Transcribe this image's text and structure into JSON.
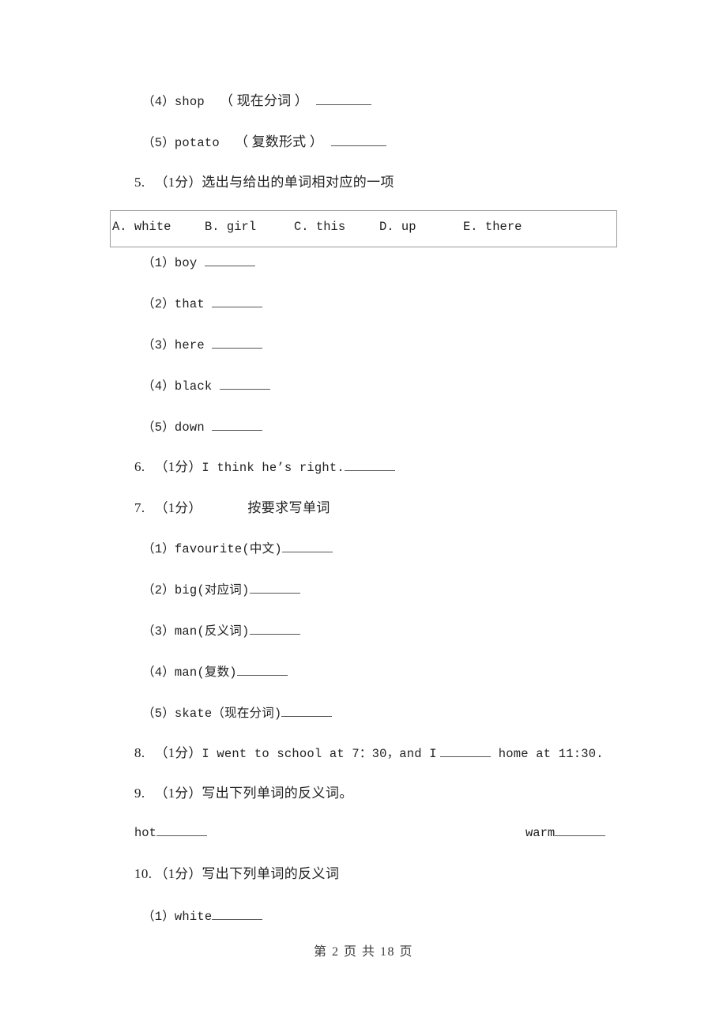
{
  "document": {
    "type": "exam-worksheet",
    "language": "zh-CN",
    "background_color": "#ffffff",
    "text_color": "#222222"
  },
  "carryover_items": [
    {
      "marker": "（4）",
      "word": "shop",
      "hint": "（ 现在分词 ）",
      "blank": "________"
    },
    {
      "marker": "（5）",
      "word": "potato",
      "hint": "（ 复数形式 ）",
      "blank": "________"
    }
  ],
  "questions": [
    {
      "number": "5.",
      "score": "（1分）",
      "prompt": "选出与给出的单词相对应的一项",
      "choices": [
        {
          "letter": "A.",
          "text": "white"
        },
        {
          "letter": "B.",
          "text": "girl"
        },
        {
          "letter": "C.",
          "text": "this"
        },
        {
          "letter": "D.",
          "text": "up"
        },
        {
          "letter": "E.",
          "text": "there"
        }
      ],
      "sub_items": [
        {
          "marker": "（1）",
          "word": "boy",
          "blank": "________"
        },
        {
          "marker": "（2）",
          "word": "that",
          "blank": "________"
        },
        {
          "marker": "（3）",
          "word": "here",
          "blank": "________"
        },
        {
          "marker": "（4）",
          "word": "black",
          "blank": "________"
        },
        {
          "marker": "（5）",
          "word": "down",
          "blank": "________"
        }
      ]
    },
    {
      "number": "6.",
      "score": "（1分）",
      "prompt": "I think he’s right.",
      "blank": "________"
    },
    {
      "number": "7.",
      "score": "（1分）",
      "prompt": "按要求写单词",
      "sub_items": [
        {
          "marker": "（1）",
          "word": "favourite(中文)",
          "blank": "________"
        },
        {
          "marker": "（2）",
          "word": "big(对应词)",
          "blank": "________"
        },
        {
          "marker": "（3）",
          "word": "man(反义词)",
          "blank": "________"
        },
        {
          "marker": "（4）",
          "word": "man(复数)",
          "blank": "________"
        },
        {
          "marker": "（5）",
          "word": "skate（现在分词)",
          "blank": "________"
        }
      ]
    },
    {
      "number": "8.",
      "score": "（1分）",
      "prompt_before": "I went to school at 7：30，and I",
      "blank": "________",
      "prompt_after": "home at 11:30."
    },
    {
      "number": "9.",
      "score": "（1分）",
      "prompt": "写出下列单词的反义词。",
      "pairs": [
        {
          "word": "hot",
          "blank": "________"
        },
        {
          "word": "warm",
          "blank": "________"
        }
      ]
    },
    {
      "number": "10.",
      "score": "（1分）",
      "prompt": "写出下列单词的反义词",
      "sub_items": [
        {
          "marker": "（1）",
          "word": "white",
          "blank": "________"
        }
      ]
    }
  ],
  "footer": {
    "text": "第 2 页 共 18 页"
  }
}
